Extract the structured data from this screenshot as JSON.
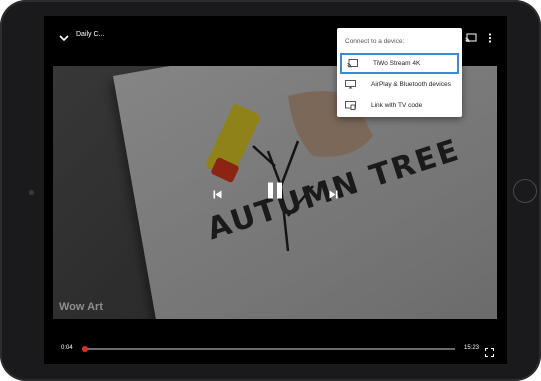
{
  "player": {
    "title": "Daily C...",
    "watermark": "Wow Art",
    "painted_text": "AUTUMN TREE",
    "current_time": "0:04",
    "duration": "15:23",
    "progress_fraction": 0.004,
    "accent": "#e52d27"
  },
  "cast_popup": {
    "header": "Connect to a device:",
    "items": [
      {
        "label": "TiWo Stream 4K",
        "icon": "cast-icon",
        "selected": true
      },
      {
        "label": "AirPlay & Bluetooth devices",
        "icon": "airplay-icon",
        "selected": false
      },
      {
        "label": "Link with TV code",
        "icon": "tv-link-icon",
        "selected": false
      }
    ],
    "highlight_color": "#3b8bd4"
  }
}
